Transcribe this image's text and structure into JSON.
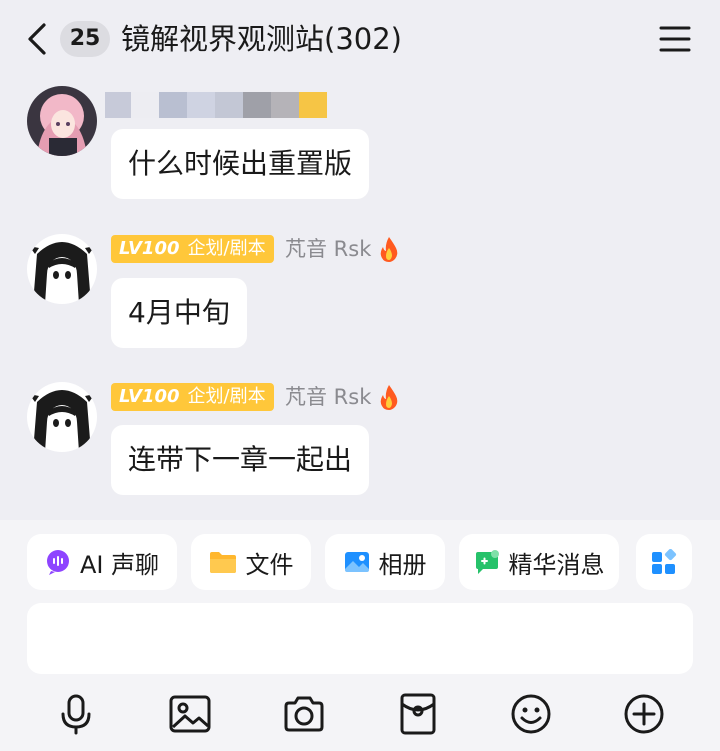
{
  "header": {
    "unread_count": "25",
    "title": "镜解视界观测站(302)"
  },
  "messages": [
    {
      "text": "什么时候出重置版"
    },
    {
      "level": "LV100",
      "role": "企划/剧本",
      "sender": "芃音 Rsk",
      "text": "4月中旬"
    },
    {
      "level": "LV100",
      "role": "企划/剧本",
      "sender": "芃音 Rsk",
      "text": "连带下一章一起出"
    }
  ],
  "quick_actions": [
    {
      "label": "AI 声聊",
      "icon": "ai-voice-icon"
    },
    {
      "label": "文件",
      "icon": "folder-icon"
    },
    {
      "label": "相册",
      "icon": "album-icon"
    },
    {
      "label": "精华消息",
      "icon": "essence-icon"
    },
    {
      "label": "",
      "icon": "apps-grid-icon"
    }
  ],
  "input": {
    "value": ""
  },
  "bottom_icons": [
    "microphone-icon",
    "image-icon",
    "camera-icon",
    "red-packet-icon",
    "emoji-icon",
    "plus-icon"
  ],
  "colors": {
    "background": "#eeeef3",
    "bubble": "#ffffff",
    "level_badge": "#ffc73a",
    "sender_name": "#8a8a8f",
    "essence_green": "#26c26a",
    "accent_blue": "#1e90ff",
    "ai_purple": "#8e44ff"
  }
}
